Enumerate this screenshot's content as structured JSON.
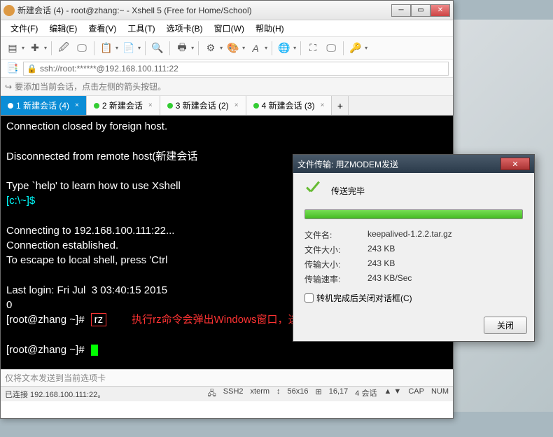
{
  "window": {
    "title": "新建会话 (4) - root@zhang:~ - Xshell 5 (Free for Home/School)"
  },
  "menu": {
    "file": "文件(F)",
    "edit": "编辑(E)",
    "view": "查看(V)",
    "tools": "工具(T)",
    "tab": "选项卡(B)",
    "window": "窗口(W)",
    "help": "帮助(H)"
  },
  "address": "ssh://root:******@192.168.100.111:22",
  "tip": "要添加当前会话，点击左侧的箭头按钮。",
  "tabs": [
    {
      "label": "1 新建会话 (4)",
      "active": true
    },
    {
      "label": "2 新建会话",
      "active": false
    },
    {
      "label": "3 新建会话 (2)",
      "active": false
    },
    {
      "label": "4 新建会话 (3)",
      "active": false
    }
  ],
  "terminal": {
    "l1": "Connection closed by foreign host.",
    "l2": "",
    "l3": "Disconnected from remote host(新建会话",
    "l4": "",
    "l5": "Type `help' to learn how to use Xshell",
    "l6a": "[c:\\~]$",
    "l7": "",
    "l8": "Connecting to 192.168.100.111:22...",
    "l9": "Connection established.",
    "l10": "To escape to local shell, press 'Ctrl",
    "l11": "",
    "l12": "Last login: Fri Jul  3 03:40:15 2015 ",
    "l13": "0",
    "l14a": "[root@zhang ~]#",
    "l14b": "rz",
    "l14c": "执行rz命令会弹出Windows窗口，选择要上传的文件点击打开即传送",
    "l15": "",
    "l16a": "[root@zhang ~]#"
  },
  "textbar": "仅将文本发送到当前选项卡",
  "status": {
    "conn": "已连接 192.168.100.111:22。",
    "ssh": "SSH2",
    "term": "xterm",
    "size": "56x16",
    "pos": "16,17",
    "sess": "4 会话",
    "cap": "CAP",
    "num": "NUM"
  },
  "dialog": {
    "title": "文件传输: 用ZMODEM发送",
    "status": "传送完毕",
    "filename_lbl": "文件名:",
    "filename": "keepalived-1.2.2.tar.gz",
    "filesize_lbl": "文件大小:",
    "filesize": "243 KB",
    "xfersize_lbl": "传输大小:",
    "xfersize": "243 KB",
    "rate_lbl": "传输速率:",
    "rate": "243 KB/Sec",
    "checkbox": "转机完成后关闭对话框(C)",
    "close": "关闭"
  }
}
